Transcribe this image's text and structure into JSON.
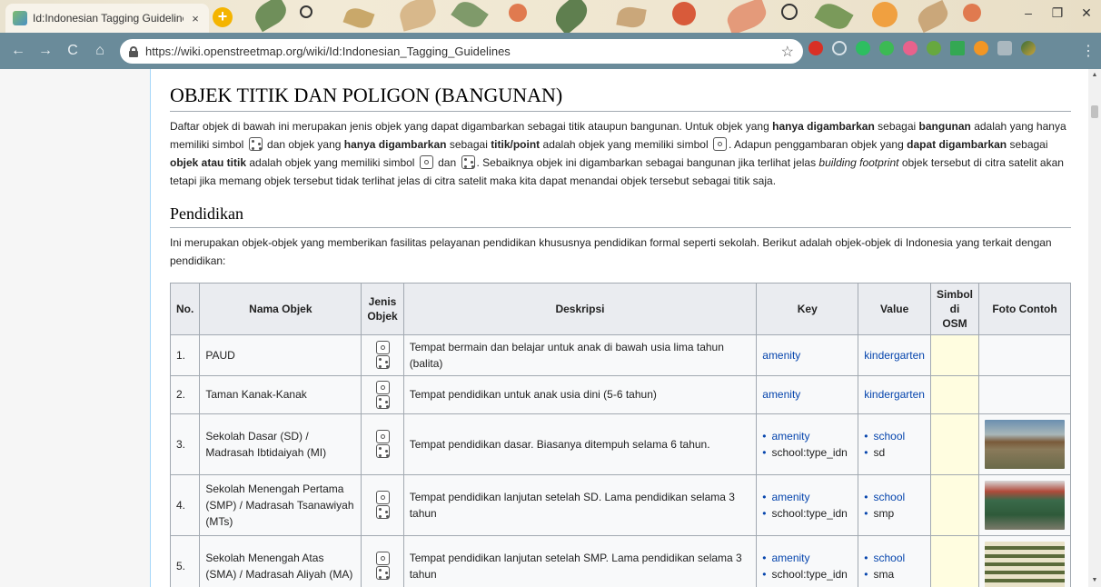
{
  "browser": {
    "tab_title": "Id:Indonesian Tagging Guidelines",
    "tab_close": "×",
    "new_tab": "+",
    "url": "https://wiki.openstreetmap.org/wiki/Id:Indonesian_Tagging_Guidelines",
    "back": "←",
    "forward": "→",
    "reload": "C",
    "home": "⌂",
    "star": "☆",
    "menu": "⋮",
    "minimize": "–",
    "restore": "❐",
    "close": "✕"
  },
  "page": {
    "heading": "OBJEK TITIK DAN POLIGON (BANGUNAN)",
    "intro": {
      "p1": "Daftar objek di bawah ini merupakan jenis objek yang dapat digambarkan sebagai titik ataupun bangunan. Untuk objek yang ",
      "b1": "hanya digambarkan",
      "p2": " sebagai ",
      "b2": "bangunan",
      "p3": " adalah yang hanya memiliki simbol ",
      "p4": " dan objek yang ",
      "b3": "hanya digambarkan",
      "p5": " sebagai ",
      "b4": "titik/point",
      "p6": " adalah objek yang memiliki simbol ",
      "p7": ". Adapun penggambaran objek yang ",
      "b5": "dapat digambarkan",
      "p8": " sebagai ",
      "b6": "objek atau titik",
      "p9": " adalah objek yang memiliki simbol ",
      "p10": " dan ",
      "p11": ". Sebaiknya objek ini digambarkan sebagai bangunan jika terlihat jelas ",
      "i1": "building footprint",
      "p12": " objek tersebut di citra satelit akan tetapi jika memang objek tersebut tidak terlihat jelas di citra satelit maka kita dapat menandai objek tersebut sebagai titik saja."
    },
    "section": {
      "heading": "Pendidikan",
      "text": "Ini merupakan objek-objek yang memberikan fasilitas pelayanan pendidikan khususnya pendidikan formal seperti sekolah. Berikut adalah objek-objek di Indonesia yang terkait dengan pendidikan:"
    },
    "table": {
      "headers": {
        "no": "No.",
        "nama": "Nama Objek",
        "jenis": "Jenis Objek",
        "deskripsi": "Deskripsi",
        "key": "Key",
        "value": "Value",
        "simbol": "Simbol di OSM",
        "foto": "Foto Contoh"
      },
      "rows": [
        {
          "no": "1.",
          "nama": "PAUD",
          "deskripsi": "Tempat bermain dan belajar untuk anak di bawah usia lima tahun (balita)",
          "key": "amenity",
          "value": "kindergarten"
        },
        {
          "no": "2.",
          "nama": "Taman Kanak-Kanak",
          "deskripsi": "Tempat pendidikan untuk anak usia dini (5-6 tahun)",
          "key": "amenity",
          "value": "kindergarten"
        },
        {
          "no": "3.",
          "nama": "Sekolah Dasar (SD) / Madrasah Ibtidaiyah (MI)",
          "deskripsi": "Tempat pendidikan dasar. Biasanya ditempuh selama 6 tahun.",
          "keys": [
            "amenity",
            "school:type_idn"
          ],
          "values": [
            "school",
            "sd"
          ]
        },
        {
          "no": "4.",
          "nama": "Sekolah Menengah Pertama (SMP) / Madrasah Tsanawiyah (MTs)",
          "deskripsi": "Tempat pendidikan lanjutan setelah SD. Lama pendidikan selama 3 tahun",
          "keys": [
            "amenity",
            "school:type_idn"
          ],
          "values": [
            "school",
            "smp"
          ]
        },
        {
          "no": "5.",
          "nama": "Sekolah Menengah Atas (SMA) / Madrasah Aliyah (MA)",
          "deskripsi": "Tempat pendidikan lanjutan setelah SMP. Lama pendidikan selama 3 tahun",
          "keys": [
            "amenity",
            "school:type_idn"
          ],
          "values": [
            "school",
            "sma"
          ]
        }
      ]
    }
  }
}
